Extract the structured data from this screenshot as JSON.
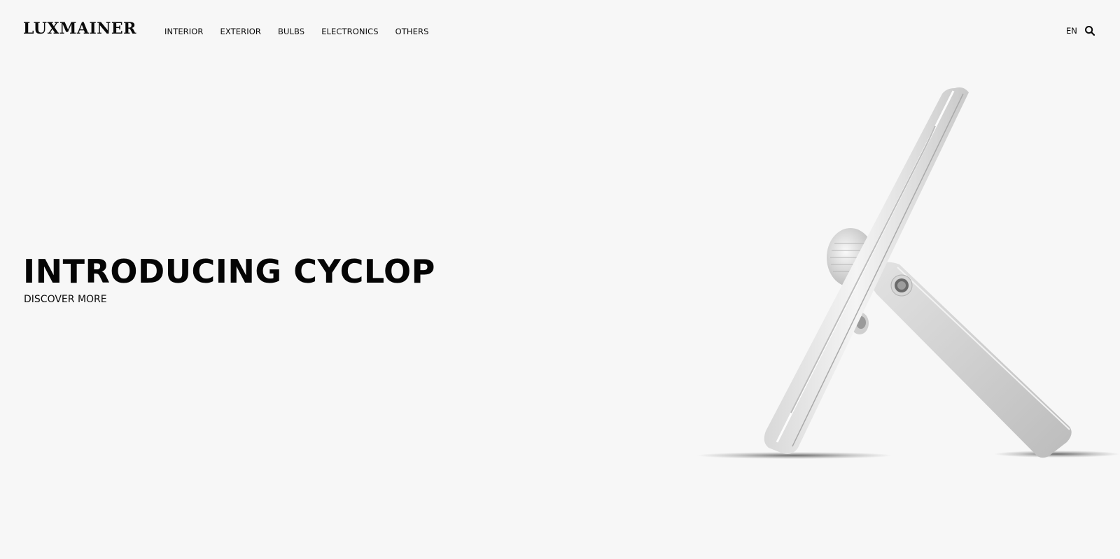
{
  "header": {
    "logo_text": "LUXMAINER",
    "nav": [
      {
        "label": "INTERIOR"
      },
      {
        "label": "EXTERIOR"
      },
      {
        "label": "BULBS"
      },
      {
        "label": "ELECTRONICS"
      },
      {
        "label": "OTHERS"
      }
    ],
    "language": "EN",
    "search_icon": "search-icon"
  },
  "hero": {
    "title": "INTRODUCING CYCLOP",
    "cta": "DISCOVER MORE",
    "image_icon": "floodlight-product-image"
  },
  "colors": {
    "background": "#f7f7f7",
    "text": "#0a0a0a"
  }
}
